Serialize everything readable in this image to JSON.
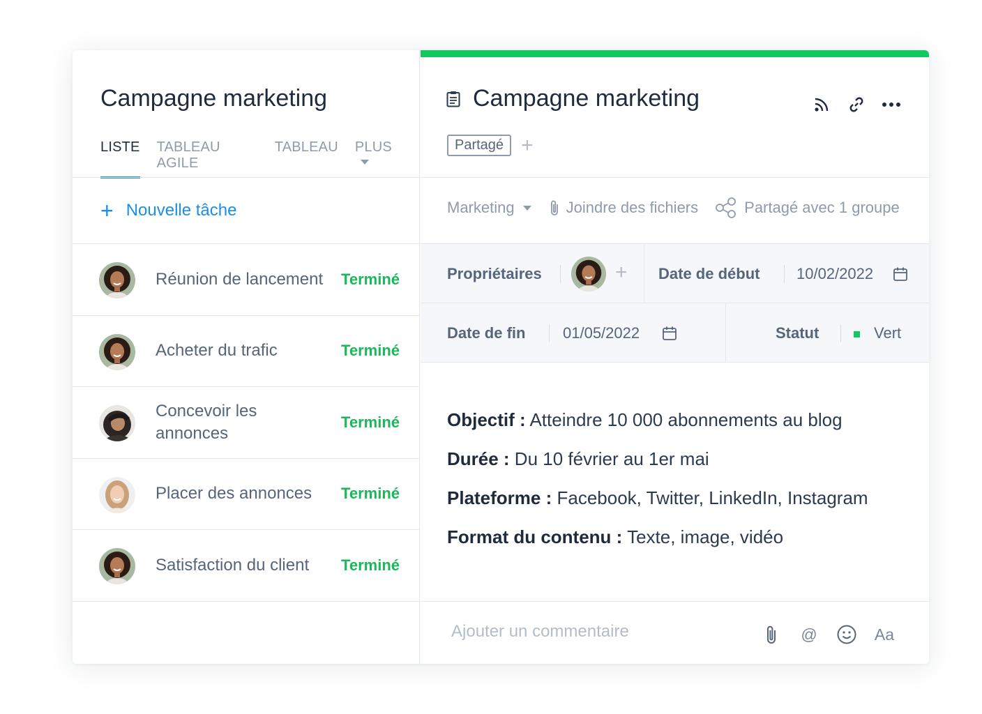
{
  "list_panel": {
    "title": "Campagne marketing",
    "tabs": [
      {
        "label": "LISTE",
        "active": true
      },
      {
        "label": "TABLEAU AGILE",
        "active": false
      },
      {
        "label": "TABLEAU",
        "active": false
      },
      {
        "label": "PLUS",
        "active": false
      }
    ],
    "new_task_label": "Nouvelle tâche",
    "tasks": [
      {
        "name": "Réunion de lancement",
        "status": "Terminé",
        "avatar": "woman-curly-hair"
      },
      {
        "name": "Acheter du trafic",
        "status": "Terminé",
        "avatar": "woman-curly-hair"
      },
      {
        "name": "Concevoir les annonces",
        "status": "Terminé",
        "avatar": "man-with-cap"
      },
      {
        "name": "Placer des annonces",
        "status": "Terminé",
        "avatar": "woman-blonde"
      },
      {
        "name": "Satisfaction du client",
        "status": "Terminé",
        "avatar": "woman-curly-hair"
      }
    ]
  },
  "detail": {
    "title": "Campagne marketing",
    "title_icon": "document-icon",
    "actions": [
      "rss-icon",
      "link-icon",
      "more-icon"
    ],
    "tag": "Partagé",
    "meta": {
      "folder": "Marketing",
      "attach": "Joindre des fichiers",
      "shared": "Partagé avec 1 groupe"
    },
    "props": {
      "owners_label": "Propriétaires",
      "start_label": "Date de début",
      "start_value": "10/02/2022",
      "end_label": "Date de fin",
      "end_value": "01/05/2022",
      "status_label": "Statut",
      "status_value": "Vert"
    },
    "description": [
      {
        "key": "Objectif :",
        "value": " Atteindre 10 000 abonnements au blog"
      },
      {
        "key": "Durée :",
        "value": " Du 10 février au 1er mai"
      },
      {
        "key": "Plateforme :",
        "value": " Facebook, Twitter, LinkedIn, Instagram"
      },
      {
        "key": "Format du contenu :",
        "value": " Texte, image, vidéo"
      }
    ],
    "comment_placeholder": "Ajouter un commentaire",
    "comment_tools": {
      "attach": "paperclip-icon",
      "mention": "@",
      "emoji": "smiley-icon",
      "format": "Aa"
    }
  },
  "colors": {
    "accent": "#1b8fe8",
    "done": "#1cb75a",
    "top_bar": "#12c95f"
  }
}
